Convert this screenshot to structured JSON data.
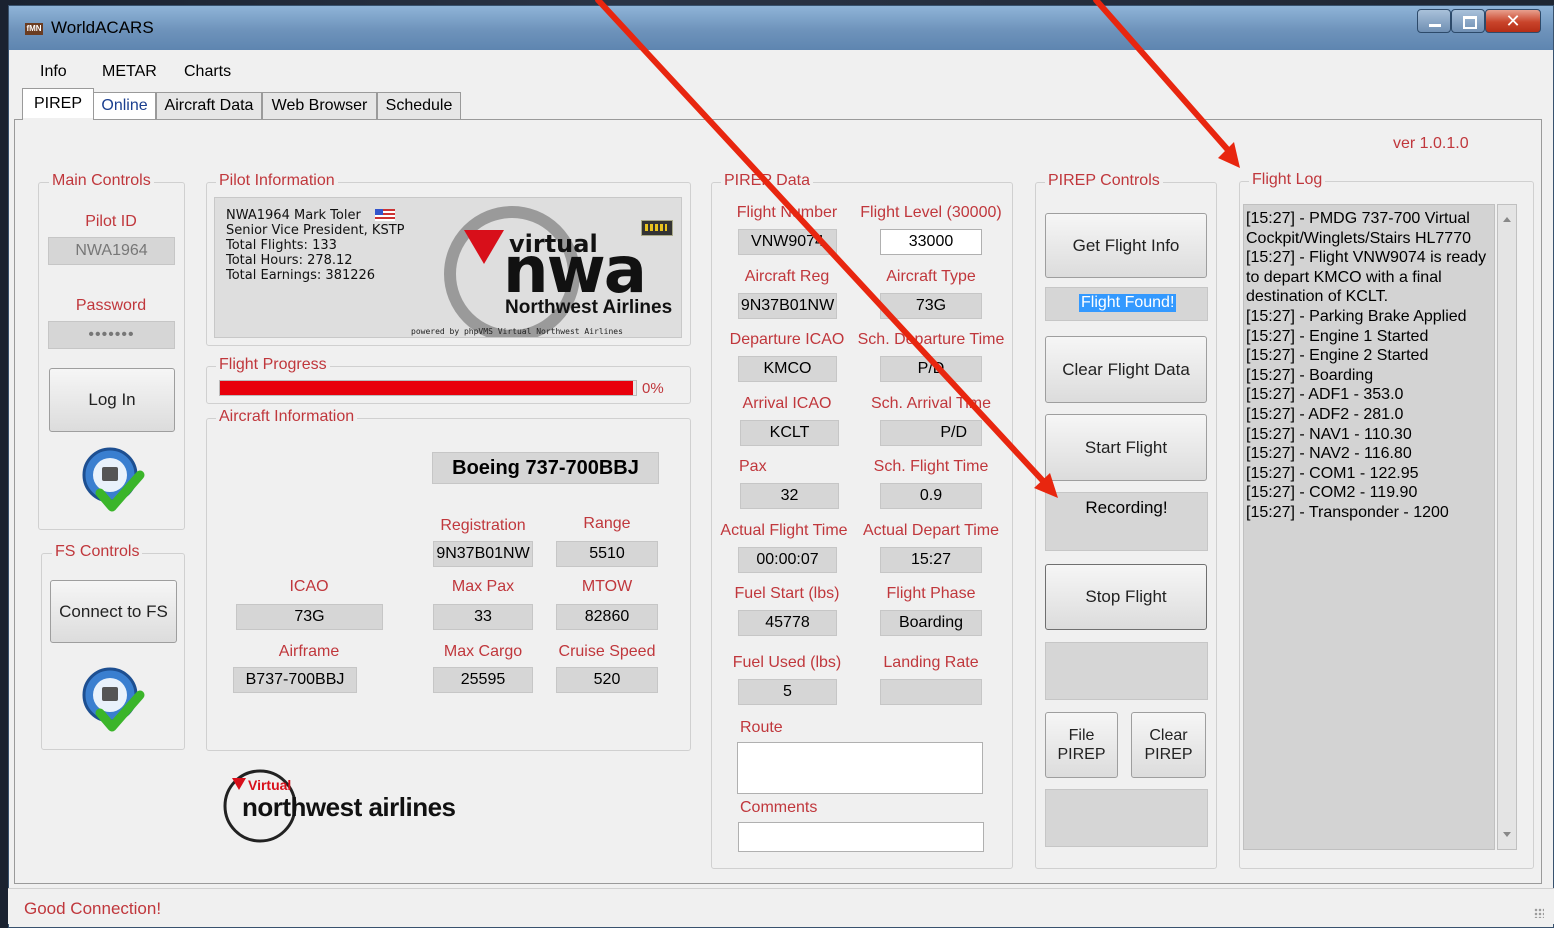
{
  "window": {
    "title": "WorldACARS",
    "app_icon_text": "fMN",
    "version": "ver 1.0.1.0"
  },
  "menu": [
    "Info",
    "METAR",
    "Charts"
  ],
  "tabs": [
    "PIREP",
    "Online",
    "Aircraft Data",
    "Web Browser",
    "Schedule"
  ],
  "main_controls": {
    "title": "Main Controls",
    "pilot_id_label": "Pilot ID",
    "pilot_id": "NWA1964",
    "password_label": "Password",
    "password": "•••••••",
    "login_button": "Log In"
  },
  "fs_controls": {
    "title": "FS Controls",
    "connect_button": "Connect to FS"
  },
  "pilot_info": {
    "title": "Pilot Information",
    "lines": [
      "NWA1964 Mark Toler",
      "Senior Vice President, KSTP",
      "Total Flights: 133",
      "Total Hours: 278.12",
      "Total Earnings: 381226"
    ],
    "banner_virtual": "virtual",
    "banner_nwa": "nwa",
    "banner_airline": "Northwest Airlines",
    "banner_powered": "powered by phpVMS Virtual Northwest Airlines"
  },
  "flight_progress": {
    "title": "Flight Progress",
    "percent_text": "0%",
    "bar_fill_fraction": 0.993
  },
  "aircraft_info": {
    "title": "Aircraft Information",
    "name": "Boeing 737-700BBJ",
    "registration_label": "Registration",
    "registration": "9N37B01NW",
    "range_label": "Range",
    "range": "5510",
    "icao_label": "ICAO",
    "icao": "73G",
    "max_pax_label": "Max Pax",
    "max_pax": "33",
    "mtow_label": "MTOW",
    "mtow": "82860",
    "airframe_label": "Airframe",
    "airframe": "B737-700BBJ",
    "max_cargo_label": "Max Cargo",
    "max_cargo": "25595",
    "cruise_speed_label": "Cruise Speed",
    "cruise_speed": "520"
  },
  "footer_logo": {
    "virtual": "Virtual",
    "name": "northwest airlines"
  },
  "pirep_data": {
    "title": "PIREP Data",
    "flight_number_label": "Flight Number",
    "flight_number": "VNW9074",
    "flight_level_label": "Flight Level (30000)",
    "flight_level": "33000",
    "aircraft_reg_label": "Aircraft Reg",
    "aircraft_reg": "9N37B01NW",
    "aircraft_type_label": "Aircraft Type",
    "aircraft_type": "73G",
    "departure_icao_label": "Departure ICAO",
    "departure_icao": "KMCO",
    "sch_departure_time_label": "Sch. Departure Time",
    "sch_departure_time": "P/D",
    "arrival_icao_label": "Arrival ICAO",
    "arrival_icao": "KCLT",
    "sch_arrival_time_label": "Sch. Arrival Time",
    "sch_arrival_time": "P/D",
    "pax_label": "Pax",
    "pax": "32",
    "sch_flight_time_label": "Sch. Flight Time",
    "sch_flight_time": "0.9",
    "actual_flight_time_label": "Actual Flight Time",
    "actual_flight_time": "00:00:07",
    "actual_depart_time_label": "Actual Depart Time",
    "actual_depart_time": "15:27",
    "fuel_start_label": "Fuel Start (lbs)",
    "fuel_start": "45778",
    "flight_phase_label": "Flight Phase",
    "flight_phase": "Boarding",
    "fuel_used_label": "Fuel Used (lbs)",
    "fuel_used": "5",
    "landing_rate_label": "Landing Rate",
    "landing_rate": "",
    "route_label": "Route",
    "route": "",
    "comments_label": "Comments",
    "comments": ""
  },
  "pirep_controls": {
    "title": "PIREP Controls",
    "get_flight_info": "Get Flight Info",
    "flight_found": "Flight Found!",
    "clear_flight_data": "Clear Flight Data",
    "start_flight": "Start Flight",
    "recording": "Recording!",
    "stop_flight": "Stop Flight",
    "file_pirep_1": "File",
    "file_pirep_2": "PIREP",
    "clear_pirep_1": "Clear",
    "clear_pirep_2": "PIREP"
  },
  "flight_log": {
    "title": "Flight Log",
    "lines": [
      "[15:27] - PMDG 737-700 Virtual",
      "Cockpit/Winglets/Stairs HL7770",
      "[15:27] - Flight VNW9074 is ready",
      "to depart KMCO with a final",
      "destination of KCLT.",
      "[15:27] - Parking Brake Applied",
      "[15:27] - Engine 1 Started",
      "[15:27] - Engine 2 Started",
      "[15:27] - Boarding",
      "[15:27] - ADF1 - 353.0",
      "[15:27] - ADF2 - 281.0",
      "[15:27] - NAV1 - 110.30",
      "[15:27] - NAV2 - 116.80",
      "[15:27] - COM1 - 122.95",
      "[15:27] - COM2 - 119.90",
      "[15:27] - Transponder - 1200"
    ]
  },
  "status": "Good Connection!",
  "colors": {
    "label_red": "#c0373c",
    "progress_red": "#e8000b",
    "highlight_blue": "#3399ff",
    "arrow_red": "#e8260f"
  }
}
